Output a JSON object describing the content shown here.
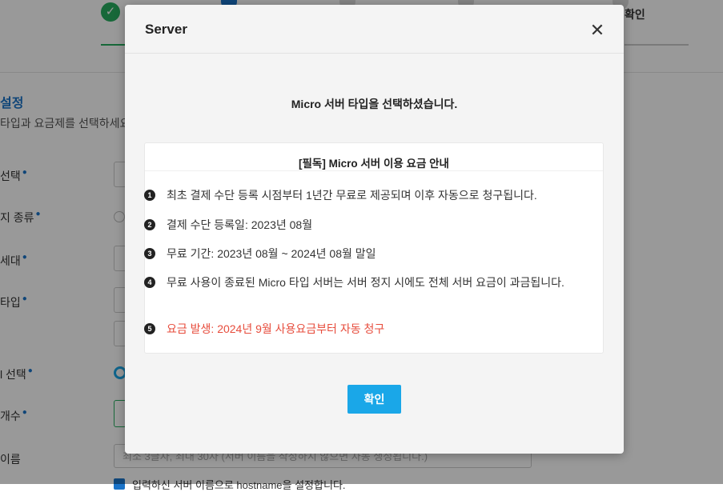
{
  "background": {
    "step_last_label": "확인",
    "section_title": "설정",
    "section_desc": "타입과 요금제를 선택하세요",
    "form_labels": [
      "선택",
      "지 종류",
      "세대",
      "타입",
      "l 선택",
      "개수",
      "이름"
    ],
    "name_placeholder": "최소 3글자, 최대 30자 (서버 이름을 작성하지 않으면 자동 생성됩니다.)",
    "checkbox_text": "입력하신 서버 이름으로 hostname을 설정합니다."
  },
  "modal": {
    "title": "Server",
    "close_icon": "close-icon",
    "message": "Micro 서버 타입을 선택하셨습니다.",
    "notice": {
      "title": "[필독] Micro 서버 이용 요금 안내",
      "items": [
        {
          "num": "1",
          "text": "최초 결제 수단 등록 시점부터 1년간 무료로 제공되며 이후 자동으로 청구됩니다."
        },
        {
          "num": "2",
          "text": "결제 수단 등록일: 2023년 08월"
        },
        {
          "num": "3",
          "text": "무료 기간: 2023년 08월 ~ 2024년 08월 말일"
        },
        {
          "num": "4",
          "text": "무료 사용이 종료된 Micro 타입 서버는 서버 정지 시에도 전체 서버 요금이 과금됩니다."
        },
        {
          "num": "5",
          "text": "요금 발생: 2024년 9월 사용요금부터 자동 청구"
        }
      ]
    },
    "confirm_label": "확인"
  },
  "colors": {
    "accent": "#1aa7e8",
    "warning_text": "#e74c3c",
    "success": "#27ae60"
  }
}
